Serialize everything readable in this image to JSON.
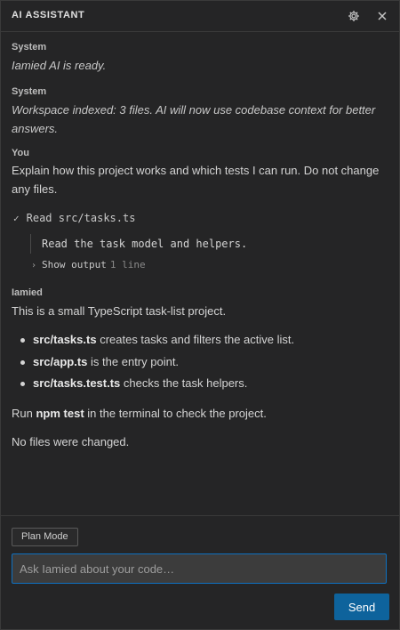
{
  "header": {
    "title": "AI ASSISTANT",
    "settings_icon": "gear-icon",
    "close_icon": "close-icon"
  },
  "messages": [
    {
      "role": "System",
      "text": "Iamied AI is ready."
    },
    {
      "role": "System",
      "text": "Workspace indexed: 3 files. AI will now use codebase context for better answers."
    },
    {
      "role": "You",
      "text": "Explain how this project works and which tests I can run. Do not change any files."
    }
  ],
  "tool_call": {
    "status_icon": "check-icon",
    "label": "Read src/tasks.ts",
    "result": "Read the task model and helpers.",
    "show_output_label": "Show output",
    "show_output_count": "1 line"
  },
  "assistant": {
    "name": "Iamied",
    "intro": "This is a small TypeScript task-list project.",
    "bullets": [
      {
        "file": "src/tasks.ts",
        "text": "creates tasks and filters the active list."
      },
      {
        "file": "src/app.ts",
        "text": "is the entry point."
      },
      {
        "file": "src/tasks.test.ts",
        "text": "checks the task helpers."
      }
    ],
    "run_prefix": "Run",
    "run_command": "npm test",
    "run_suffix": "in the terminal to check the project.",
    "outro": "No files were changed."
  },
  "composer": {
    "plan_mode_label": "Plan Mode",
    "placeholder": "Ask Iamied about your code…",
    "send_label": "Send"
  },
  "colors": {
    "background": "#252526",
    "accent": "#0e639c",
    "input_border": "#0e70c0"
  }
}
